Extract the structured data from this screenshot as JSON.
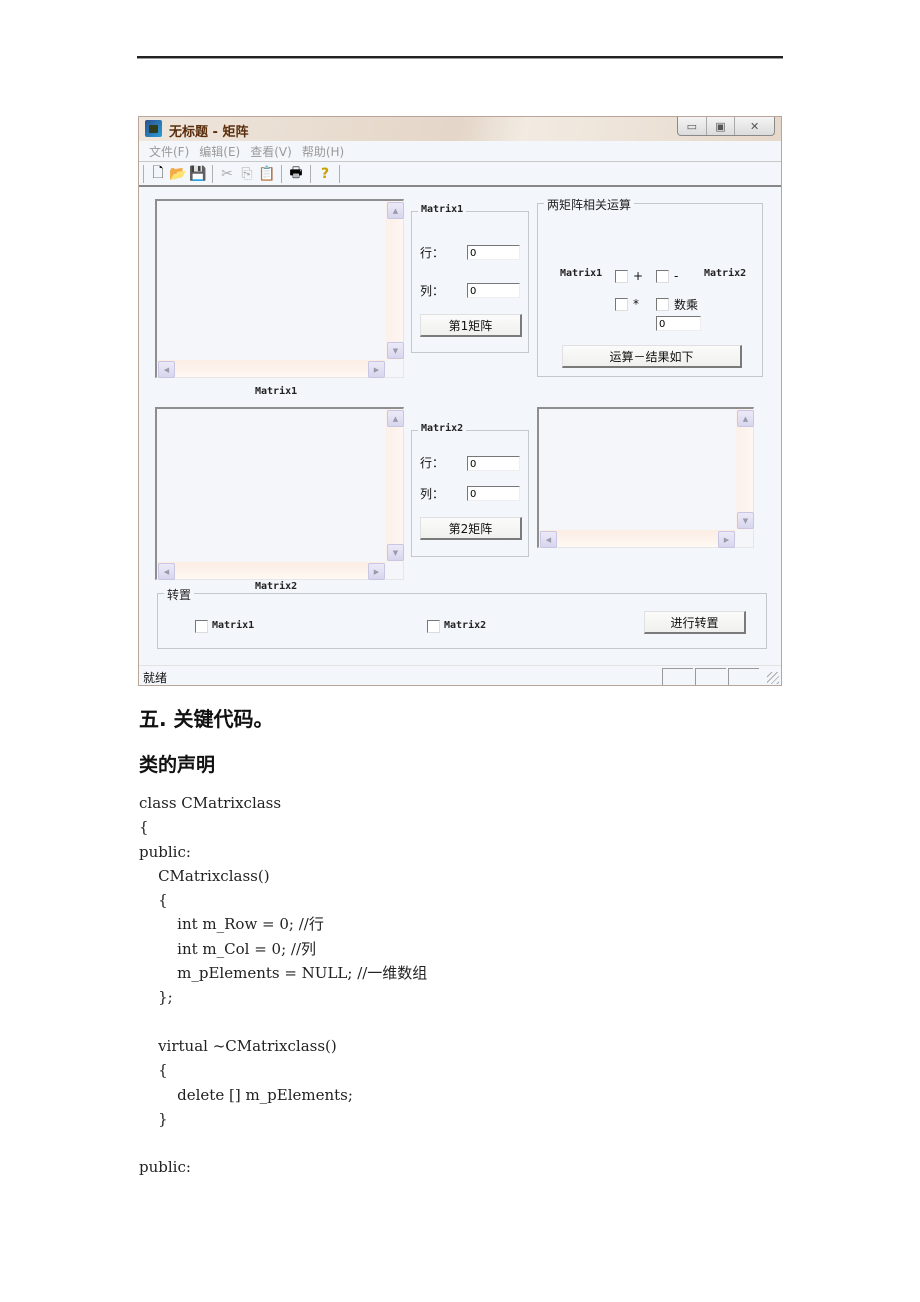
{
  "window": {
    "title": "无标题 - 矩阵",
    "controls": {
      "minimize": "▭",
      "maximize": "▣",
      "close": "✕"
    },
    "menu": [
      "文件(F)",
      "编辑(E)",
      "查看(V)",
      "帮助(H)"
    ],
    "toolbar": [
      {
        "icon": "new-file-icon",
        "glyph": "🗋"
      },
      {
        "icon": "open-folder-icon",
        "glyph": "📂"
      },
      {
        "icon": "save-icon",
        "glyph": "💾"
      },
      {
        "icon": "cut-icon",
        "glyph": "✂"
      },
      {
        "icon": "copy-icon",
        "glyph": "⎘"
      },
      {
        "icon": "paste-icon",
        "glyph": "📋"
      },
      {
        "icon": "print-icon",
        "glyph": "🖶"
      },
      {
        "icon": "help-icon",
        "glyph": "?"
      }
    ],
    "matrix1_list_caption": "Matrix1",
    "matrix2_list_caption": "Matrix2",
    "matrix1_group": {
      "label": "Matrix1",
      "row_label": "行：",
      "row_value": "0",
      "col_label": "列：",
      "col_value": "0",
      "button": "第1矩阵"
    },
    "matrix2_group": {
      "label": "Matrix2",
      "row_label": "行：",
      "row_value": "0",
      "col_label": "列：",
      "col_value": "0",
      "button": "第2矩阵"
    },
    "ops_group": {
      "label": "两矩阵相关运算",
      "left_label": "Matrix1",
      "right_label": "Matrix2",
      "plus": "+",
      "minus": "-",
      "multiply": "*",
      "scalar": "数乘",
      "scalar_value": "0",
      "button": "运算－结果如下"
    },
    "transpose_group": {
      "label": "转置",
      "check1": "Matrix1",
      "check2": "Matrix2",
      "button": "进行转置"
    },
    "status": "就绪"
  },
  "doc": {
    "heading": "五. 关键代码。",
    "subheading": "类的声明",
    "code": "class CMatrixclass\n{\npublic:\n    CMatrixclass()\n    {\n        int m_Row = 0; //行\n        int m_Col = 0; //列\n        m_pElements = NULL; //一维数组\n    };\n\n    virtual ~CMatrixclass()\n    {\n        delete [] m_pElements;\n    }\n\npublic:"
  }
}
